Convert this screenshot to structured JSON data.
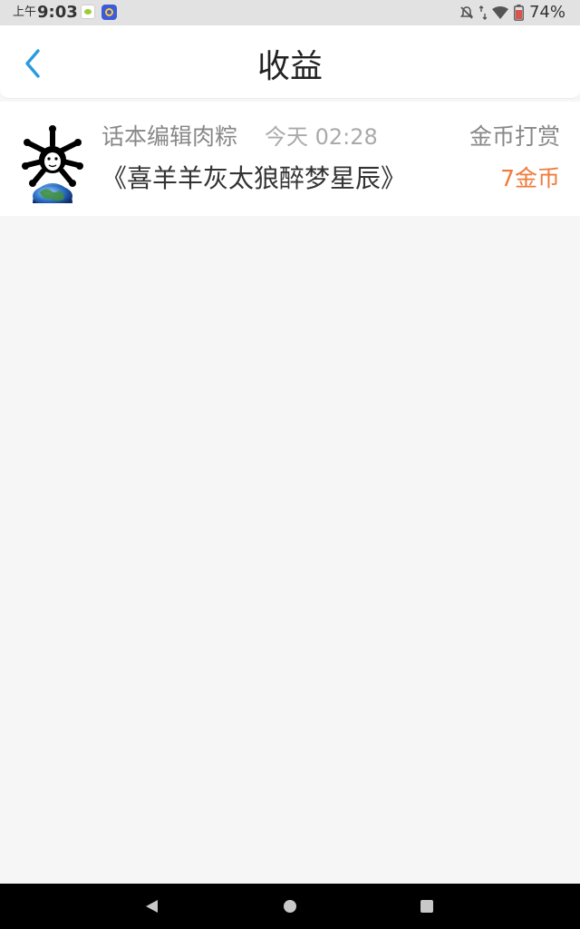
{
  "status_bar": {
    "ampm": "上午",
    "time": "9:03",
    "battery": "74%",
    "icons": [
      "app-notification-icon",
      "app-notification-icon-2",
      "mute-icon",
      "data-arrows-icon",
      "wifi-icon",
      "battery-icon"
    ]
  },
  "header": {
    "title": "收益",
    "back_icon": "chevron-left-icon",
    "accent_color": "#2a9ae0"
  },
  "records": [
    {
      "user_name": "话本编辑肉粽",
      "time": "今天 02:28",
      "reward_type": "金币打赏",
      "work_title": "《喜羊羊灰太狼醉梦星辰》",
      "amount": "7金币",
      "amount_color": "#f07a3a"
    }
  ],
  "nav_bar": {
    "icons": [
      "back-triangle-icon",
      "home-circle-icon",
      "recents-square-icon"
    ]
  }
}
